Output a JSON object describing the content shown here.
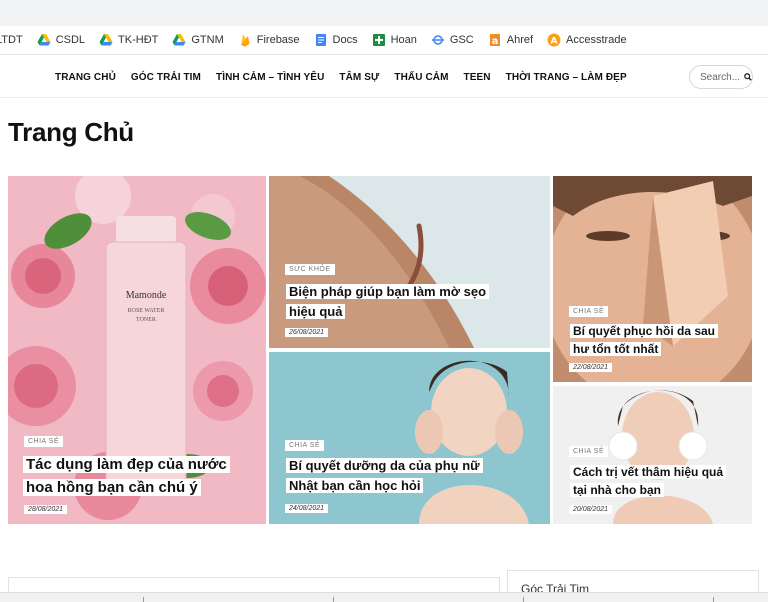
{
  "bookmarks": [
    {
      "label": "LTDT",
      "icon": "none"
    },
    {
      "label": "CSDL",
      "icon": "google-drive-icon"
    },
    {
      "label": "TK-HĐT",
      "icon": "google-drive-icon"
    },
    {
      "label": "GTNM",
      "icon": "google-drive-icon"
    },
    {
      "label": "Firebase",
      "icon": "firebase-icon"
    },
    {
      "label": "Docs",
      "icon": "google-docs-icon"
    },
    {
      "label": "Hoan",
      "icon": "green-cross-icon"
    },
    {
      "label": "GSC",
      "icon": "search-console-icon"
    },
    {
      "label": "Ahref",
      "icon": "ahrefs-icon"
    },
    {
      "label": "Accesstrade",
      "icon": "accesstrade-icon"
    }
  ],
  "nav": {
    "items": [
      "TRANG CHỦ",
      "GÓC TRẢI TIM",
      "TÌNH CẢM – TÌNH YÊU",
      "TÂM SỰ",
      "THẤU CẢM",
      "TEEN",
      "THỜI TRANG – LÀM ĐẸP"
    ],
    "search_label": "Search"
  },
  "page_title": "Trang Chủ",
  "posts": [
    {
      "category": "CHIA SẺ",
      "title_lines": [
        "Tác dụng làm đẹp của nước",
        "hoa hồng bạn cần chú ý"
      ],
      "date": "28/08/2021",
      "image": "rose-water-toner",
      "product_text": [
        "Mamonde",
        "ROSE WATER",
        "TONER"
      ]
    },
    {
      "category": "SỨC KHỎE",
      "title_lines": [
        "Biện pháp giúp bạn làm mờ sẹo",
        "hiệu quả"
      ],
      "date": "26/08/2021",
      "image": "scar-on-skin"
    },
    {
      "category": "CHIA SẺ",
      "title_lines": [
        "Bí quyết phục hồi da sau",
        "hư tổn tốt nhất"
      ],
      "date": "22/08/2021",
      "image": "peeling-skin-face"
    },
    {
      "category": "CHIA SẺ",
      "title_lines": [
        "Bí quyết dưỡng da của phụ nữ",
        "Nhật bạn cần học hỏi"
      ],
      "date": "24/08/2021",
      "image": "woman-touching-face"
    },
    {
      "category": "CHIA SẺ",
      "title_lines": [
        "Cách trị vết thâm hiệu quả",
        "tại nhà cho bạn"
      ],
      "date": "20/08/2021",
      "image": "woman-washing-face"
    }
  ],
  "sidebar": {
    "heading": "Góc Trải Tim"
  },
  "colors": {
    "accesstrade": "#f6a21a",
    "firebase": "#ffa000",
    "docs": "#4285f4",
    "green": "#1e8e3e"
  }
}
